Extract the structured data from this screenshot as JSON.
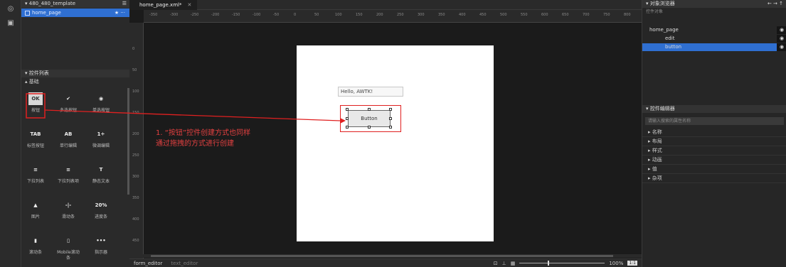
{
  "left_panel": {
    "template_header": "▾ 480_480_template",
    "template_item": "home_page",
    "controls_header": "▾ 控件列表",
    "basic_header": "▴ 基础",
    "widgets": [
      {
        "label": "按钮",
        "icon": "OK"
      },
      {
        "label": "多选按钮",
        "icon": "✔"
      },
      {
        "label": "单选按钮",
        "icon": "◉"
      },
      {
        "label": "标签按钮",
        "icon": "TAB"
      },
      {
        "label": "单行编辑",
        "icon": "AB"
      },
      {
        "label": "微调编辑",
        "icon": "1÷"
      },
      {
        "label": "下拉列表",
        "icon": "≡"
      },
      {
        "label": "下拉列表项",
        "icon": "≡"
      },
      {
        "label": "静态文本",
        "icon": "T"
      },
      {
        "label": "图片",
        "icon": "▲"
      },
      {
        "label": "滑动条",
        "icon": "-|-"
      },
      {
        "label": "进度条",
        "icon": "20%"
      },
      {
        "label": "滚动条",
        "icon": "▮"
      },
      {
        "label": "Mobile滚动条",
        "icon": "▯"
      },
      {
        "label": "指示器",
        "icon": "•••"
      }
    ]
  },
  "canvas": {
    "tab_title": "home_page.xml*",
    "tab_close": "✕",
    "h_ticks": [
      "-350",
      "-300",
      "-250",
      "-200",
      "-150",
      "-100",
      "-50",
      "0",
      "50",
      "100",
      "150",
      "200",
      "250",
      "300",
      "350",
      "400",
      "450",
      "500",
      "550",
      "600",
      "650",
      "700",
      "750",
      "800"
    ],
    "v_ticks": [
      "0",
      "50",
      "100",
      "150",
      "200",
      "250",
      "300",
      "350",
      "400",
      "450",
      "500"
    ],
    "edit_text": "Hello, AWTK!",
    "button_text": "Button",
    "annotation_line1": "1. “按钮”控件创建方式也同样",
    "annotation_line2": "通过拖拽的方式进行创建",
    "bottom_tabs": [
      "form_editor",
      "text_editor"
    ],
    "zoom_level": "100%",
    "zoom_btn": "1:1"
  },
  "right_panel": {
    "object_browser_header": "▾ 对象浏览器",
    "controls_object_label": "控件对象",
    "tree": [
      {
        "label": "home_page",
        "level": 0,
        "selected": false
      },
      {
        "label": "edit",
        "level": 1,
        "selected": false
      },
      {
        "label": "button",
        "level": 1,
        "selected": true
      }
    ],
    "editor_header": "▾ 控件编辑器",
    "search_placeholder": "请输入搜索的属性名称",
    "properties": [
      "名称",
      "布局",
      "样式",
      "动画",
      "值",
      "杂项"
    ]
  },
  "colors": {
    "accent_blue": "#2f6fd1",
    "annotation_red": "#e34040",
    "background": "#1b1b1b"
  }
}
